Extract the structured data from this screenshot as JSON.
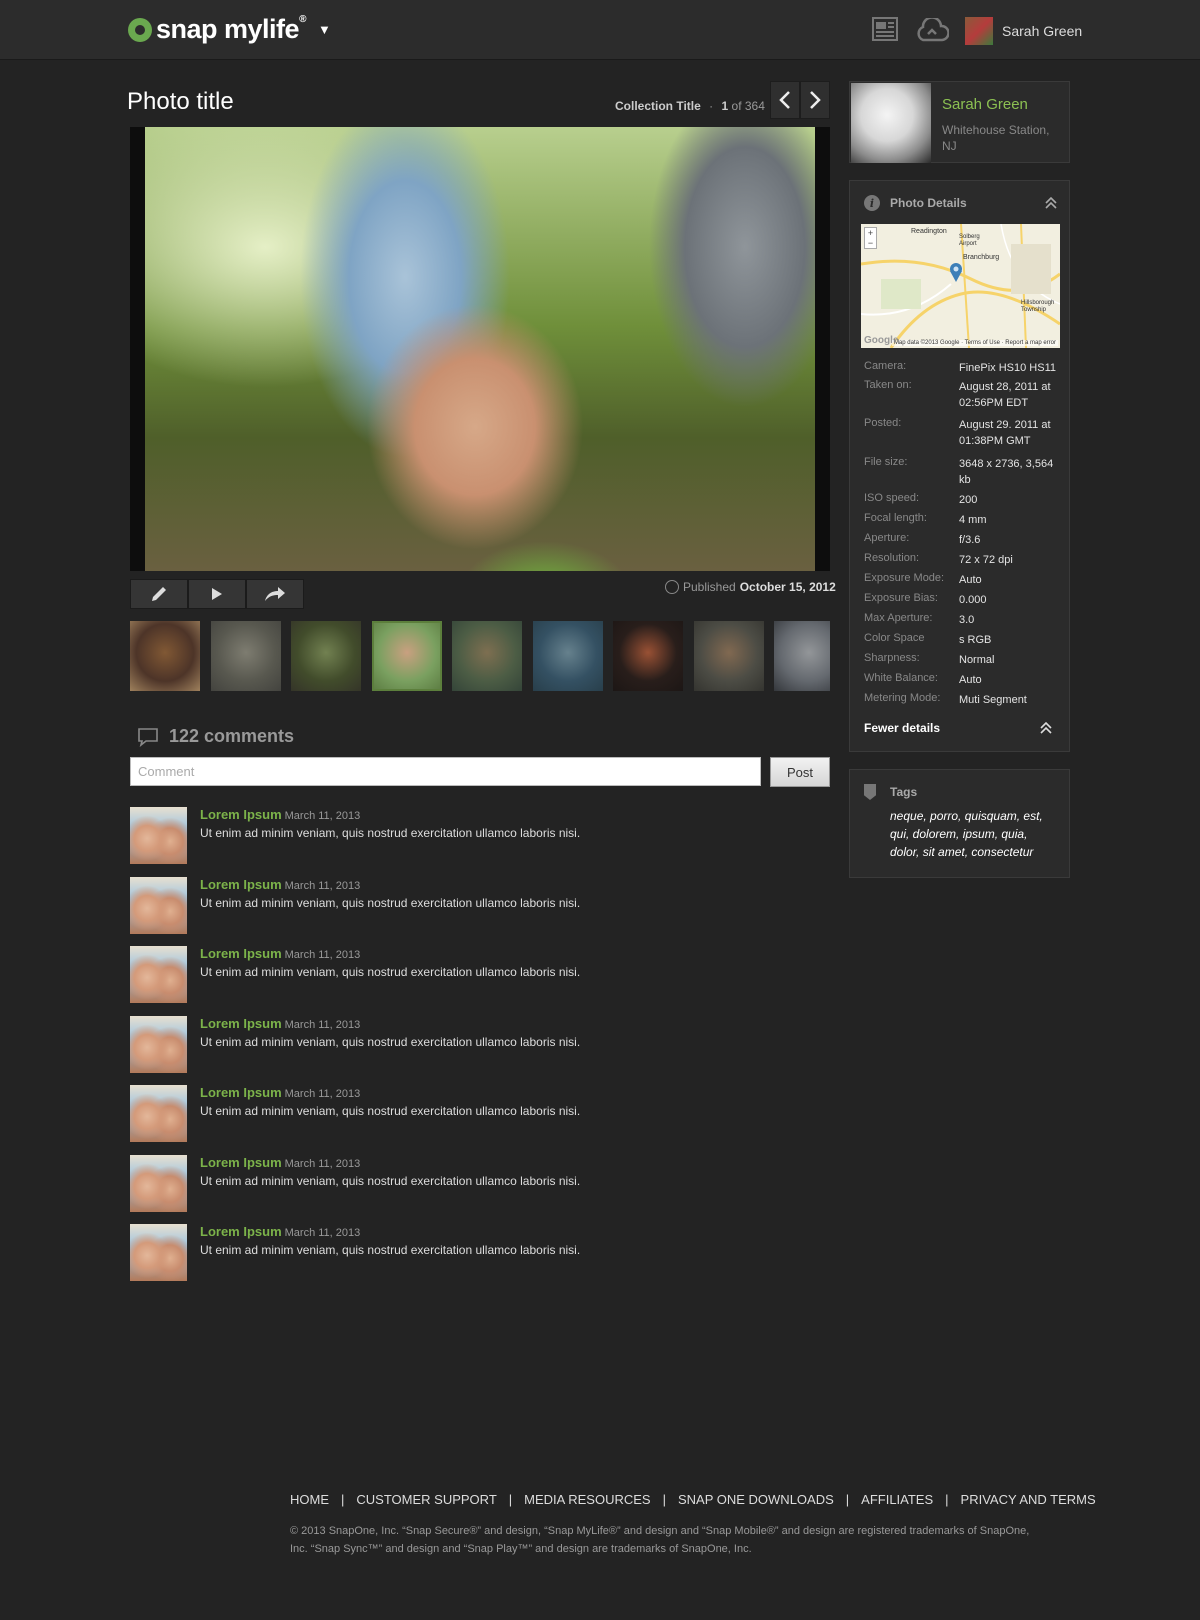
{
  "header": {
    "logo_text": "snap mylife",
    "logo_reg": "®",
    "logo_caret": "▼",
    "user_name": "Sarah Green"
  },
  "photo": {
    "title": "Photo title",
    "collection_title": "Collection Title",
    "separator": "·",
    "index": "1",
    "of_text": "of 364",
    "prev_label": "‹",
    "next_label": "›",
    "published_label": "Published",
    "published_date": "October 15, 2012"
  },
  "thumbnails": [
    {
      "colors": [
        "#5b3a2a",
        "#a06a3a",
        "#c8a070"
      ]
    },
    {
      "colors": [
        "#6a6a5e",
        "#9c9a8a",
        "#4e4e48"
      ]
    },
    {
      "colors": [
        "#4c5a2e",
        "#8ca060",
        "#3a3a2a"
      ]
    },
    {
      "colors": [
        "#7aa060",
        "#c9a080",
        "#5a7a40"
      ]
    },
    {
      "colors": [
        "#5a7050",
        "#9c8860",
        "#3a5040"
      ]
    },
    {
      "colors": [
        "#3a6078",
        "#7ca0b0",
        "#2a4858"
      ]
    },
    {
      "colors": [
        "#2a1c18",
        "#c0603a",
        "#1a1210"
      ]
    },
    {
      "colors": [
        "#5a5a50",
        "#a08060",
        "#3a3a34"
      ]
    },
    {
      "colors": [
        "#7a8088",
        "#b8bcc0",
        "#3a3e44"
      ]
    }
  ],
  "comments": {
    "count_text": "122 comments",
    "placeholder": "Comment",
    "post_label": "Post",
    "items": [
      {
        "author": "Lorem Ipsum",
        "date": "March 11, 2013",
        "text": "Ut enim ad minim veniam, quis nostrud exercitation ullamco laboris nisi."
      },
      {
        "author": "Lorem Ipsum",
        "date": "March 11, 2013",
        "text": "Ut enim ad minim veniam, quis nostrud exercitation ullamco laboris nisi."
      },
      {
        "author": "Lorem Ipsum",
        "date": "March 11, 2013",
        "text": "Ut enim ad minim veniam, quis nostrud exercitation ullamco laboris nisi."
      },
      {
        "author": "Lorem Ipsum",
        "date": "March 11, 2013",
        "text": "Ut enim ad minim veniam, quis nostrud exercitation ullamco laboris nisi."
      },
      {
        "author": "Lorem Ipsum",
        "date": "March 11, 2013",
        "text": "Ut enim ad minim veniam, quis nostrud exercitation ullamco laboris nisi."
      },
      {
        "author": "Lorem Ipsum",
        "date": "March 11, 2013",
        "text": "Ut enim ad minim veniam, quis nostrud exercitation ullamco laboris nisi."
      },
      {
        "author": "Lorem Ipsum",
        "date": "March 11, 2013",
        "text": "Ut enim ad minim veniam, quis nostrud exercitation ullamco laboris nisi."
      }
    ]
  },
  "profile": {
    "name": "Sarah Green",
    "location": "Whitehouse Station, NJ"
  },
  "details": {
    "heading": "Photo Details",
    "map": {
      "labels": [
        "Readington",
        "Solberg Airport",
        "Branchburg",
        "Hillsborough Township"
      ],
      "credit": "Map data ©2013 Google · Terms of Use · Report a map error",
      "brand": "Google"
    },
    "specs": [
      {
        "key": "Camera:",
        "value": "FinePix HS10 HS11"
      },
      {
        "key": "Taken on:",
        "value": "August 28, 2011 at 02:56PM EDT"
      },
      {
        "key": "Posted:",
        "value": "August 29. 2011 at 01:38PM GMT"
      },
      {
        "key": "File size:",
        "value": "3648 x 2736, 3,564 kb"
      },
      {
        "key": "ISO speed:",
        "value": "200"
      },
      {
        "key": "Focal length:",
        "value": "4 mm"
      },
      {
        "key": "Aperture:",
        "value": "f/3.6"
      },
      {
        "key": "Resolution:",
        "value": "72 x 72 dpi"
      },
      {
        "key": "Exposure Mode:",
        "value": "Auto"
      },
      {
        "key": "Exposure Bias:",
        "value": "0.000"
      },
      {
        "key": "Max Aperture:",
        "value": "3.0"
      },
      {
        "key": "Color Space",
        "value": "s RGB"
      },
      {
        "key": "Sharpness:",
        "value": "Normal"
      },
      {
        "key": "White Balance:",
        "value": "Auto"
      },
      {
        "key": "Metering Mode:",
        "value": "Muti Segment"
      }
    ],
    "fewer_label": "Fewer details"
  },
  "tags": {
    "heading": "Tags",
    "text": "neque, porro, quisquam, est, qui, dolorem, ipsum, quia, dolor, sit amet, consectetur"
  },
  "footer": {
    "links": [
      "HOME",
      "CUSTOMER SUPPORT",
      "MEDIA RESOURCES",
      "SNAP ONE DOWNLOADS",
      "AFFILIATES",
      "PRIVACY AND TERMS"
    ],
    "separator": "|",
    "legal": "© 2013 SnapOne, Inc. “Snap Secure®” and design, “Snap MyLife®” and design and “Snap Mobile®” and design are registered trademarks of SnapOne, Inc. “Snap Sync™” and design and “Snap Play™” and design are trademarks of SnapOne, Inc."
  },
  "colors": {
    "background": "#232323",
    "accent_green": "#7cb34a",
    "panel": "#2b2b2b"
  }
}
